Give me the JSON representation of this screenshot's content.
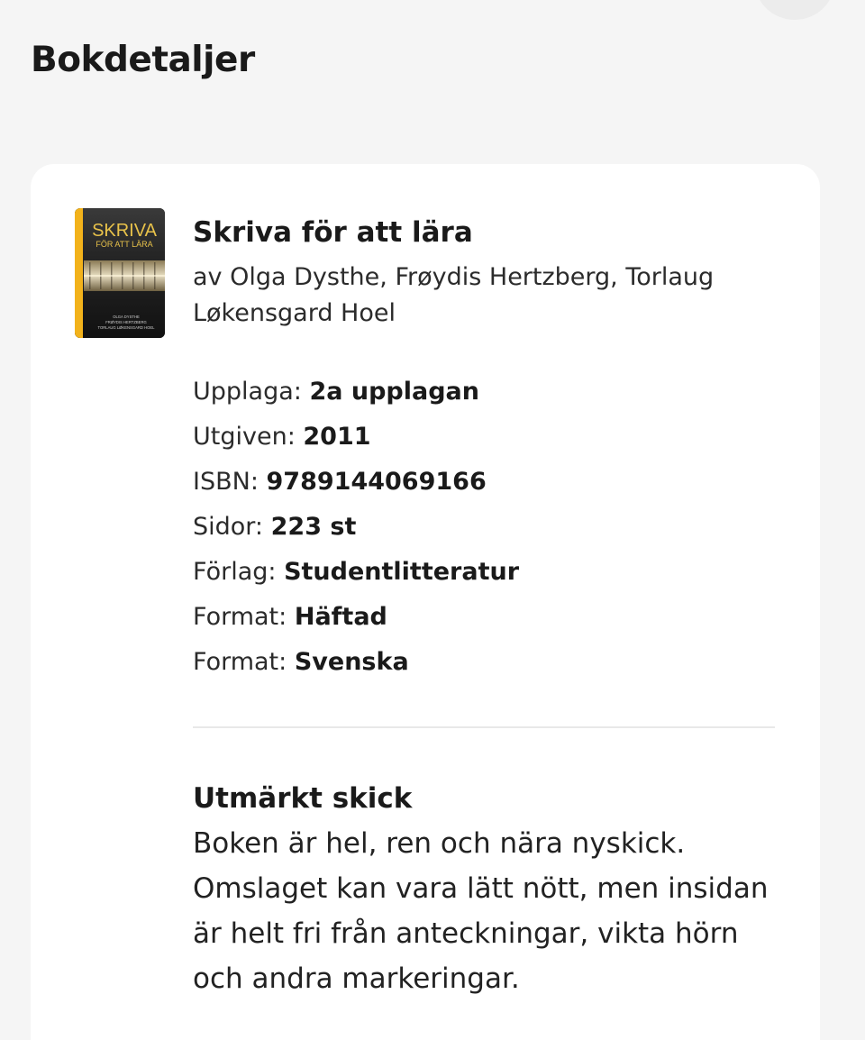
{
  "page": {
    "title": "Bokdetaljer"
  },
  "book": {
    "cover": {
      "alt": "Skriva för att lära cover",
      "title_line1": "SKRIVA",
      "title_line2": "FÖR ATT LÄRA",
      "authors_line1": "OLGA DYSTHE",
      "authors_line2": "FRØYDIS HERTZBERG",
      "authors_line3": "TORLAUG LØKENSGARD HOEL",
      "accent_color": "#f2b21b"
    },
    "title": "Skriva för att lära",
    "authors": "av Olga Dysthe, Frøydis Hertzberg, Torlaug Løkensgard Hoel",
    "details": [
      {
        "label": "Upplaga:",
        "value": "2a upplagan"
      },
      {
        "label": "Utgiven:",
        "value": "2011"
      },
      {
        "label": "ISBN:",
        "value": "9789144069166"
      },
      {
        "label": "Sidor:",
        "value": "223 st"
      },
      {
        "label": "Förlag:",
        "value": "Studentlitteratur"
      },
      {
        "label": "Format:",
        "value": "Häftad"
      },
      {
        "label": "Format:",
        "value": "Svenska"
      }
    ]
  },
  "condition": {
    "title": "Utmärkt skick",
    "text": "Boken är hel, ren och nära nyskick. Omslaget kan vara lätt nött, men insidan är helt fri från anteckningar, vikta hörn och andra markeringar."
  }
}
